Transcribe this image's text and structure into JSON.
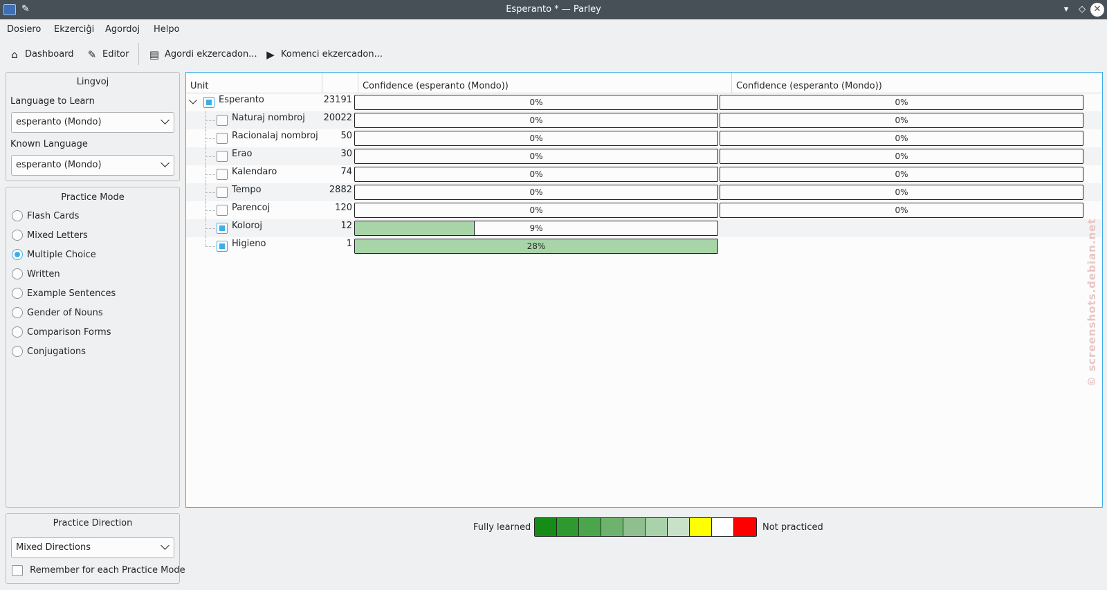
{
  "window": {
    "title": "Esperanto * — Parley",
    "pin_icon": "pin-icon",
    "buttons": {
      "minimize": "▾",
      "maximize": "◇",
      "close": "✕"
    }
  },
  "menu": [
    {
      "label": "Dosiero"
    },
    {
      "label": "Ekzerciĝi"
    },
    {
      "label": "Agordoj"
    },
    {
      "label": "Helpo"
    }
  ],
  "toolbar": {
    "dashboard": "Dashboard",
    "editor": "Editor",
    "configure": "Agordi ekzercadon...",
    "start": "Komenci ekzercadon..."
  },
  "languages": {
    "title": "Lingvoj",
    "learn_label": "Language to Learn",
    "learn_value": "esperanto (Mondo)",
    "known_label": "Known Language",
    "known_value": "esperanto (Mondo)"
  },
  "practice_mode": {
    "title": "Practice Mode",
    "selected": "Multiple Choice",
    "options": [
      {
        "label": "Flash Cards",
        "checked": false
      },
      {
        "label": "Mixed Letters",
        "checked": false
      },
      {
        "label": "Multiple Choice",
        "checked": true
      },
      {
        "label": "Written",
        "checked": false
      },
      {
        "label": "Example Sentences",
        "checked": false
      },
      {
        "label": "Gender of Nouns",
        "checked": false
      },
      {
        "label": "Comparison Forms",
        "checked": false
      },
      {
        "label": "Conjugations",
        "checked": false
      }
    ]
  },
  "practice_direction": {
    "title": "Practice Direction",
    "value": "Mixed Directions",
    "remember_label": "Remember for each Practice Mode",
    "remember_checked": false
  },
  "table": {
    "headers": {
      "unit": "Unit",
      "count": "",
      "conf1": "Confidence (esperanto (Mondo))",
      "conf2": "Confidence (esperanto (Mondo))"
    },
    "rows": [
      {
        "name": "Esperanto",
        "count": "23191",
        "checked": true,
        "level": 0,
        "conf1": 0,
        "conf1_label": "0%",
        "conf2": 0,
        "conf2_label": "0%"
      },
      {
        "name": "Naturaj nombroj",
        "count": "20022",
        "checked": false,
        "level": 1,
        "conf1": 0,
        "conf1_label": "0%",
        "conf2": 0,
        "conf2_label": "0%"
      },
      {
        "name": "Racionalaj nombroj",
        "count": "50",
        "checked": false,
        "level": 1,
        "conf1": 0,
        "conf1_label": "0%",
        "conf2": 0,
        "conf2_label": "0%"
      },
      {
        "name": "Erao",
        "count": "30",
        "checked": false,
        "level": 1,
        "conf1": 0,
        "conf1_label": "0%",
        "conf2": 0,
        "conf2_label": "0%"
      },
      {
        "name": "Kalendaro",
        "count": "74",
        "checked": false,
        "level": 1,
        "conf1": 0,
        "conf1_label": "0%",
        "conf2": 0,
        "conf2_label": "0%"
      },
      {
        "name": "Tempo",
        "count": "2882",
        "checked": false,
        "level": 1,
        "conf1": 0,
        "conf1_label": "0%",
        "conf2": 0,
        "conf2_label": "0%"
      },
      {
        "name": "Parencoj",
        "count": "120",
        "checked": false,
        "level": 1,
        "conf1": 0,
        "conf1_label": "0%",
        "conf2": 0,
        "conf2_label": "0%"
      },
      {
        "name": "Koloroj",
        "count": "12",
        "checked": true,
        "level": 1,
        "conf1": 0.33,
        "conf1_label": "9%",
        "conf2": null,
        "conf2_label": null
      },
      {
        "name": "Higieno",
        "count": "1",
        "checked": true,
        "level": 1,
        "conf1": 1.0,
        "conf1_label": "28%",
        "conf2": null,
        "conf2_label": null
      }
    ]
  },
  "legend": {
    "left_label": "Fully learned",
    "right_label": "Not practiced",
    "colors": [
      "#158c15",
      "#2e992e",
      "#4ba64b",
      "#6db36d",
      "#8fbf8f",
      "#aad2aa",
      "#c9e0c9",
      "#ffff00",
      "#ffffff",
      "#ff0000"
    ]
  },
  "watermark": "© screenshots.debian.net",
  "fill_color": "#a8d5a8"
}
